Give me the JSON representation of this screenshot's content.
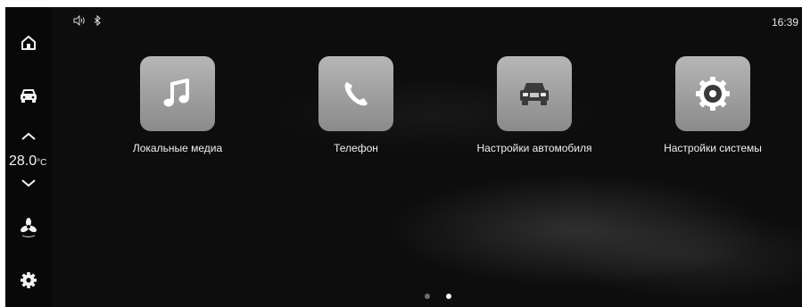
{
  "status_bar": {
    "volume_icon": "volume-icon",
    "bluetooth_icon": "bluetooth-icon",
    "time": "16:39"
  },
  "sidebar": {
    "home_icon": "home-icon",
    "car_icon": "car-icon",
    "temp_up_icon": "chevron-up-icon",
    "temperature": {
      "value": "28.0",
      "unit": "°C"
    },
    "temp_down_icon": "chevron-down-icon",
    "fan_icon": "fan-icon",
    "settings_icon": "gear-icon"
  },
  "apps": [
    {
      "label": "Локальные медиа",
      "icon": "music-note-icon"
    },
    {
      "label": "Телефон",
      "icon": "phone-icon"
    },
    {
      "label": "Настройки автомобиля",
      "icon": "car-front-icon"
    },
    {
      "label": "Настройки системы",
      "icon": "settings-disc-icon"
    }
  ],
  "pagination": {
    "pages": 2,
    "active": 2,
    "active_color": "#ffffff",
    "inactive_color": "#6e6e6e"
  }
}
